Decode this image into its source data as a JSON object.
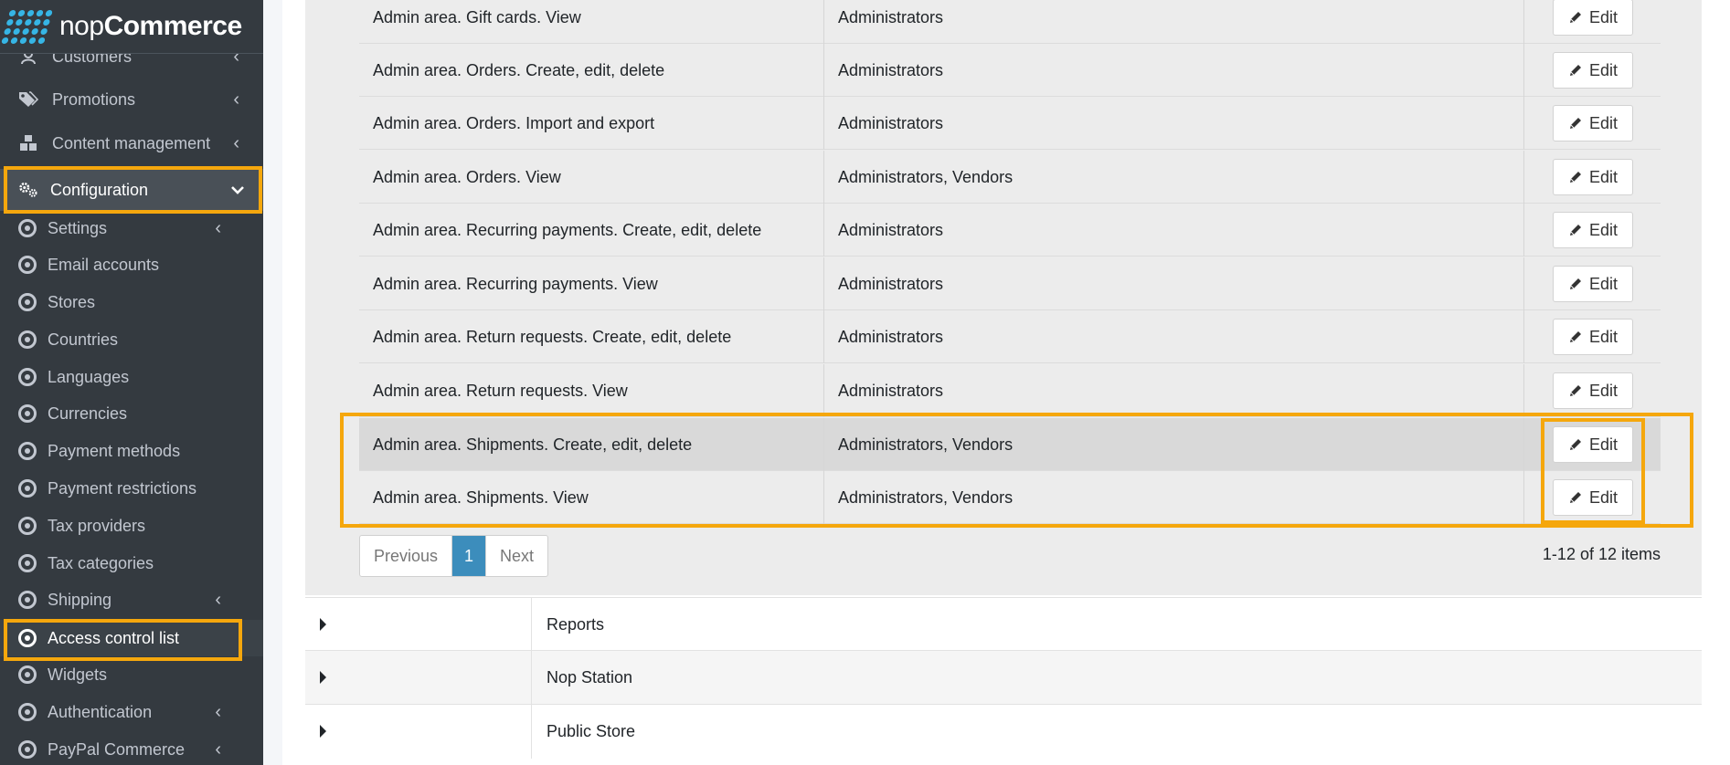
{
  "brand": {
    "name_light": "nop",
    "name_bold": "Commerce"
  },
  "sidebar": {
    "customers": "Customers",
    "promotions": "Promotions",
    "content_management": "Content management",
    "configuration": "Configuration",
    "sub_items": {
      "settings": "Settings",
      "email_accounts": "Email accounts",
      "stores": "Stores",
      "countries": "Countries",
      "languages": "Languages",
      "currencies": "Currencies",
      "payment_methods": "Payment methods",
      "payment_restrictions": "Payment restrictions",
      "tax_providers": "Tax providers",
      "tax_categories": "Tax categories",
      "shipping": "Shipping",
      "access_control_list": "Access control list",
      "widgets": "Widgets",
      "authentication": "Authentication",
      "paypal_commerce": "PayPal Commerce"
    }
  },
  "table": {
    "edit_label": "Edit",
    "rows": [
      {
        "permission": "Admin area. Gift cards. View",
        "roles": "Administrators"
      },
      {
        "permission": "Admin area. Orders. Create, edit, delete",
        "roles": "Administrators"
      },
      {
        "permission": "Admin area. Orders. Import and export",
        "roles": "Administrators"
      },
      {
        "permission": "Admin area. Orders. View",
        "roles": "Administrators, Vendors"
      },
      {
        "permission": "Admin area. Recurring payments. Create, edit, delete",
        "roles": "Administrators"
      },
      {
        "permission": "Admin area. Recurring payments. View",
        "roles": "Administrators"
      },
      {
        "permission": "Admin area. Return requests. Create, edit, delete",
        "roles": "Administrators"
      },
      {
        "permission": "Admin area. Return requests. View",
        "roles": "Administrators"
      },
      {
        "permission": "Admin area. Shipments. Create, edit, delete",
        "roles": "Administrators, Vendors"
      },
      {
        "permission": "Admin area. Shipments. View",
        "roles": "Administrators, Vendors"
      }
    ]
  },
  "pagination": {
    "previous": "Previous",
    "current": "1",
    "next": "Next",
    "info": "1-12 of 12 items"
  },
  "accordion": [
    "Reports",
    "Nop Station",
    "Public Store"
  ],
  "colors": {
    "highlight": "#f5a70d",
    "sidebar_bg": "#343a40",
    "accent": "#3c8dbc",
    "logo_dots": "#36b5e5"
  }
}
